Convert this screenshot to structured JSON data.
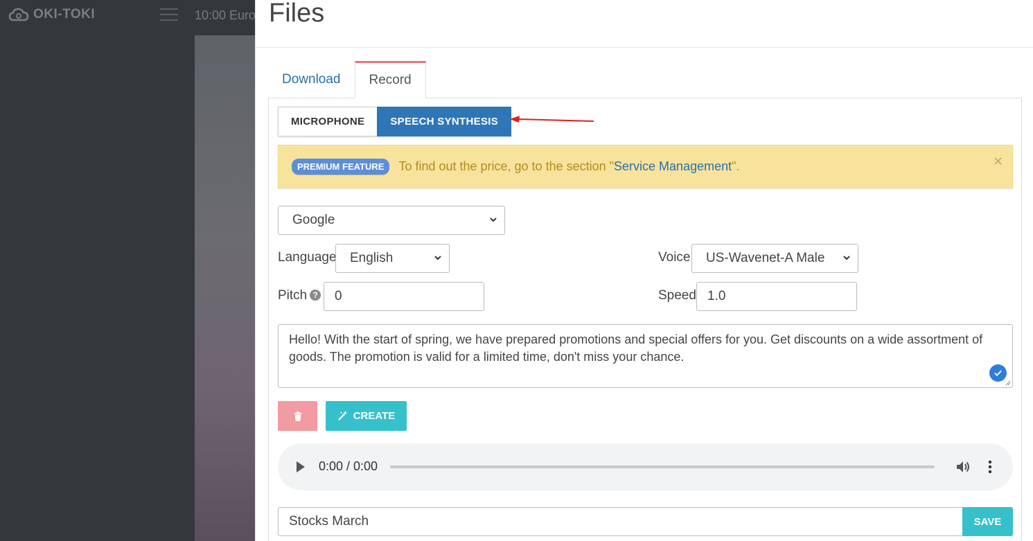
{
  "app": {
    "logo_text": "OKI-TOKI",
    "clock_text": "10:00  Euro"
  },
  "panel": {
    "title": "Files"
  },
  "tabs": [
    {
      "label": "Download",
      "active": false
    },
    {
      "label": "Record",
      "active": true
    }
  ],
  "record_mode": {
    "options": [
      {
        "label": "MICROPHONE",
        "selected": false
      },
      {
        "label": "SPEECH SYNTHESIS",
        "selected": true
      }
    ]
  },
  "alert": {
    "badge": "PREMIUM FEATURE",
    "text_before": "To find out the price, go to the section \"",
    "link_text": "Service Management",
    "text_after": "\".",
    "close_symbol": "×"
  },
  "form": {
    "engine_value": "Google",
    "language_label": "Language",
    "language_value": "English",
    "voice_label": "Voice",
    "voice_value": "US-Wavenet-A Male",
    "pitch_label": "Pitch",
    "pitch_value": "0",
    "speed_label": "Speed",
    "speed_value": "1.0",
    "text_value": "Hello! With the start of spring, we have prepared promotions and special offers for you. Get discounts on a wide assortment of goods. The promotion is valid for a limited time, don't miss your chance."
  },
  "actions": {
    "create_label": "CREATE"
  },
  "audio_player": {
    "time_text": "0:00 / 0:00"
  },
  "save_bar": {
    "name_value": "Stocks March",
    "save_label": "SAVE"
  },
  "colors": {
    "primary": "#2f76b6",
    "accent_teal": "#35c0cc",
    "danger_light": "#f29ba2",
    "alert_bg": "#f7e39c",
    "badge_bg": "#5b8edb",
    "annotation_arrow": "#e02020"
  }
}
